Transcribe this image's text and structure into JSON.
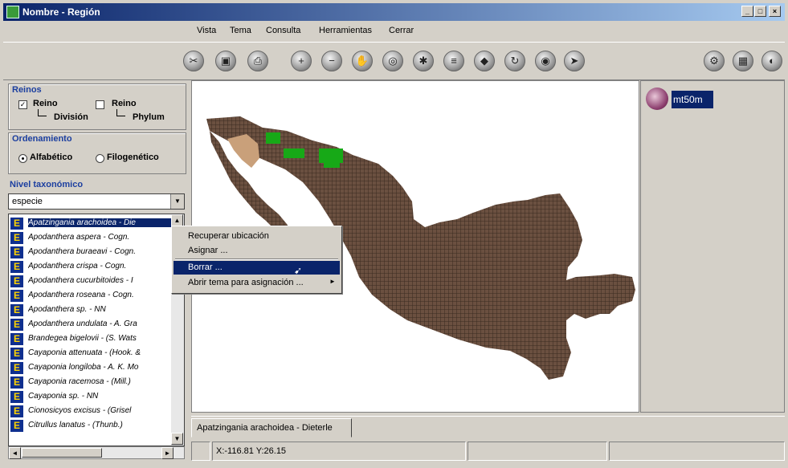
{
  "window": {
    "title": "Nombre - Región"
  },
  "menu": [
    "Vista",
    "Tema",
    "Consulta",
    "Herramientas",
    "Cerrar"
  ],
  "toolbar": {
    "tools": [
      "cut-icon",
      "layout-icon",
      "print-icon",
      "zoom-in-icon",
      "zoom-out-icon",
      "pan-icon",
      "globe-icon",
      "identify-icon",
      "table-icon",
      "select-icon",
      "refresh-icon",
      "query-icon",
      "locate-icon"
    ],
    "right_tools": [
      "options-icon",
      "map-icon",
      "world-icon"
    ]
  },
  "reinos": {
    "title": "Reinos",
    "opt1": "Reino",
    "opt1_sub": "División",
    "opt2": "Reino",
    "opt2_sub": "Phylum"
  },
  "ordenamiento": {
    "title": "Ordenamiento",
    "opt1": "Alfabético",
    "opt2": "Filogenético",
    "selected": "Alfabético"
  },
  "nivel": {
    "title": "Nivel taxonómico",
    "value": "especie"
  },
  "species": [
    "Apatzingania arachoidea - Die",
    "Apodanthera aspera - Cogn.",
    "Apodanthera buraeavi - Cogn.",
    "Apodanthera crispa - Cogn.",
    "Apodanthera cucurbitoides - I",
    "Apodanthera roseana - Cogn.",
    "Apodanthera sp. - NN",
    "Apodanthera undulata - A. Gra",
    "Brandegea bigelovii - (S. Wats",
    "Cayaponia attenuata - (Hook. &",
    "Cayaponia longiloba - A. K. Mo",
    "Cayaponia racemosa - (Mill.)",
    "Cayaponia sp. - NN",
    "Cionosicyos excisus - (Grisel",
    "Citrullus lanatus - (Thunb.)"
  ],
  "context_menu": [
    "Recuperar ubicación",
    "Asignar ...",
    "Borrar ...",
    "Abrir tema para asignación ..."
  ],
  "layers": {
    "name": "mt50m"
  },
  "tab": "Apatzingania arachoidea - Dieterle",
  "status": {
    "coords": "X:-116.81 Y:26.15"
  },
  "colors": {
    "map_fill": "#6b5040",
    "map_grid": "#3a2a20",
    "selected_cells": "#17a917",
    "highlight_region": "#c9a07a"
  }
}
